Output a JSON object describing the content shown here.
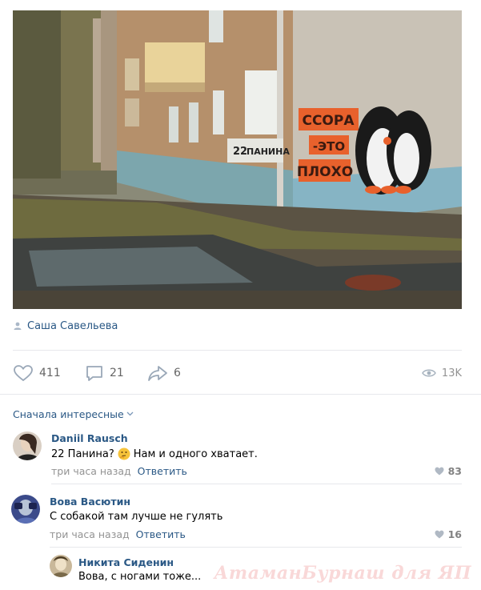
{
  "post": {
    "author": "Саша Савельева",
    "photo": {
      "graffiti_line1": "ССОРА",
      "graffiti_line2": "-ЭТО",
      "graffiti_line3": "ПЛОХО",
      "house_number": "22",
      "street_sign": "ПАНИНА"
    },
    "stats": {
      "likes": "411",
      "comments": "21",
      "shares": "6",
      "views": "13K"
    }
  },
  "comments_header": {
    "sort_label": "Сначала интересные"
  },
  "comments": [
    {
      "author": "Daniil Rausch",
      "text_before_emoji": "22 Панина?",
      "emoji": "thinking-face-emoji",
      "text_after_emoji": "Нам и одного хватает.",
      "time": "три часа назад",
      "reply_label": "Ответить",
      "likes": "83"
    },
    {
      "author": "Вова Васютин",
      "text": "С собакой там лучше не гулять",
      "time": "три часа назад",
      "reply_label": "Ответить",
      "likes": "16"
    },
    {
      "author": "Никита Сиденин",
      "text": "Вова, с ногами тоже..."
    }
  ],
  "watermark": "АтаманБурнаш для ЯП",
  "colors": {
    "link": "#2a5885",
    "muted": "#939393",
    "divider": "#e7e8ec",
    "graffiti_orange": "#e8612c"
  }
}
